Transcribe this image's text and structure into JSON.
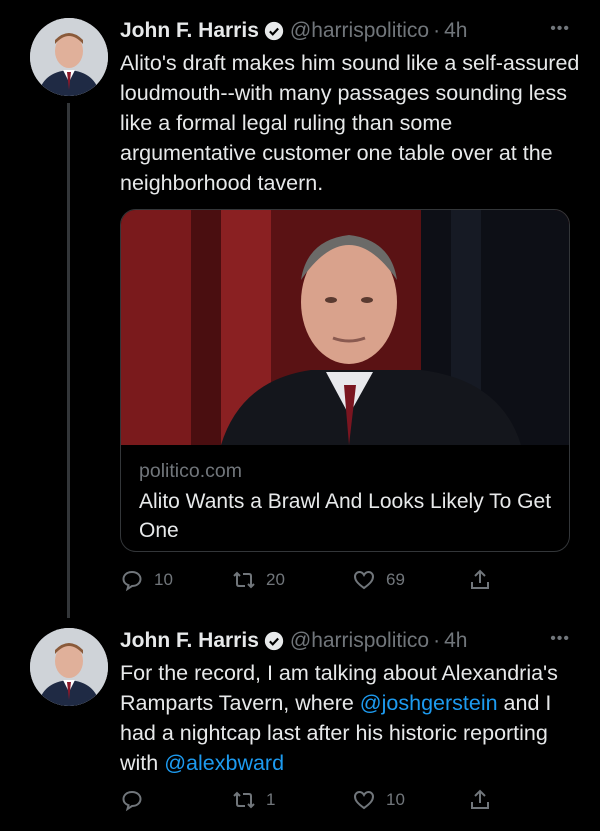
{
  "tweets": [
    {
      "author_name": "John F. Harris",
      "handle": "@harrispolitico",
      "separator": "·",
      "time": "4h",
      "text": "Alito's draft makes him sound like a self-assured loudmouth--with many passages sounding less like a formal legal ruling than some argumentative customer one table over at the neighborhood tavern.",
      "card": {
        "domain": "politico.com",
        "title": "Alito Wants a Brawl And Looks Likely To Get One"
      },
      "replies": "10",
      "retweets": "20",
      "likes": "69"
    },
    {
      "author_name": "John F. Harris",
      "handle": "@harrispolitico",
      "separator": "·",
      "time": "4h",
      "text_part1": "For the record, I am talking about Alexandria's Ramparts Tavern, where ",
      "mention1": "@joshgerstein",
      "text_part2": " and I had a nightcap last after his historic reporting with ",
      "mention2": "@alexbward",
      "replies": "",
      "retweets": "1",
      "likes": "10"
    }
  ],
  "colors": {
    "background": "#000000",
    "text": "#e7e9ea",
    "muted": "#71767b",
    "link": "#1d9bf0",
    "border": "#333639"
  },
  "icons": [
    "verified-badge-icon",
    "more-icon",
    "reply-icon",
    "retweet-icon",
    "like-icon",
    "share-icon"
  ]
}
